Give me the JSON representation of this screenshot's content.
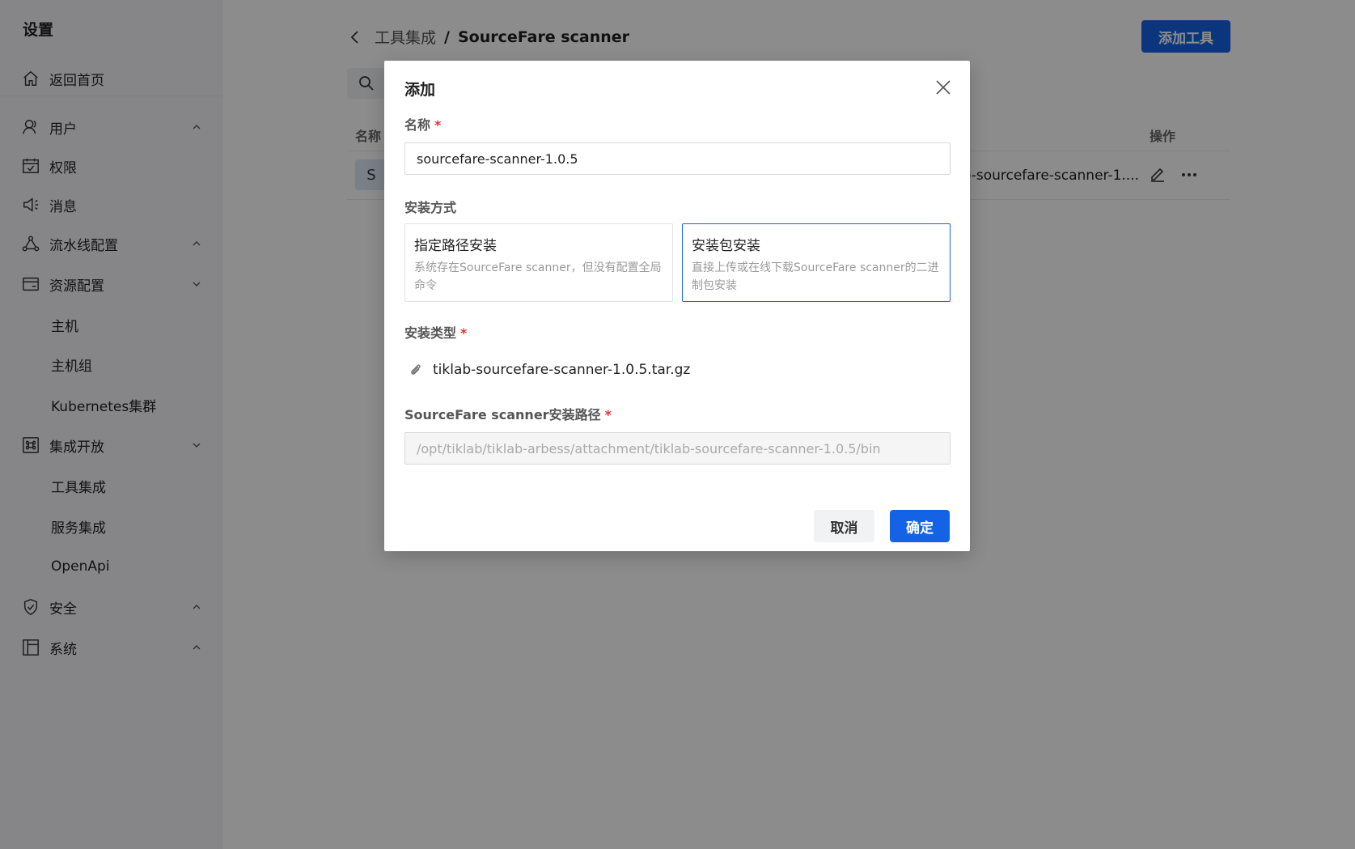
{
  "sidebar": {
    "title": "设置",
    "home": "返回首页",
    "items": [
      {
        "label": "用户",
        "icon": "user-icon",
        "chevron": "up"
      },
      {
        "label": "权限",
        "icon": "permission-icon"
      },
      {
        "label": "消息",
        "icon": "message-icon"
      },
      {
        "label": "流水线配置",
        "icon": "pipeline-icon",
        "chevron": "up"
      },
      {
        "label": "资源配置",
        "icon": "resource-icon",
        "chevron": "down"
      },
      {
        "label": "主机"
      },
      {
        "label": "主机组"
      },
      {
        "label": "Kubernetes集群"
      },
      {
        "label": "集成开放",
        "icon": "integration-icon",
        "chevron": "down"
      },
      {
        "label": "工具集成"
      },
      {
        "label": "服务集成"
      },
      {
        "label": "OpenApi"
      },
      {
        "label": "安全",
        "icon": "security-icon",
        "chevron": "up"
      },
      {
        "label": "系统",
        "icon": "system-icon",
        "chevron": "up"
      }
    ]
  },
  "page": {
    "breadcrumb_parent": "工具集成",
    "breadcrumb_sep": "/",
    "breadcrumb_current": "SourceFare scanner",
    "add_button": "添加工具",
    "col_name": "名称",
    "col_action": "操作",
    "row_avatar": "S",
    "row_path": "o-sourcefare-scanner-1...."
  },
  "modal": {
    "title": "添加",
    "name_label": "名称",
    "name_value": "sourcefare-scanner-1.0.5",
    "install_method_label": "安装方式",
    "option_path_title": "指定路径安装",
    "option_path_desc": "系统存在SourceFare scanner，但没有配置全局命令",
    "option_package_title": "安装包安装",
    "option_package_desc": "直接上传或在线下载SourceFare scanner的二进制包安装",
    "install_type_label": "安装类型",
    "file_name": "tiklab-sourcefare-scanner-1.0.5.tar.gz",
    "path_label": "SourceFare scanner安装路径",
    "path_value": "/opt/tiklab/tiklab-arbess/attachment/tiklab-sourcefare-scanner-1.0.5/bin",
    "cancel": "取消",
    "confirm": "确定",
    "required_mark": "*"
  },
  "colors": {
    "primary": "#1463e6",
    "required": "#e6313b",
    "overlay": "rgba(0,0,0,0.45)"
  }
}
